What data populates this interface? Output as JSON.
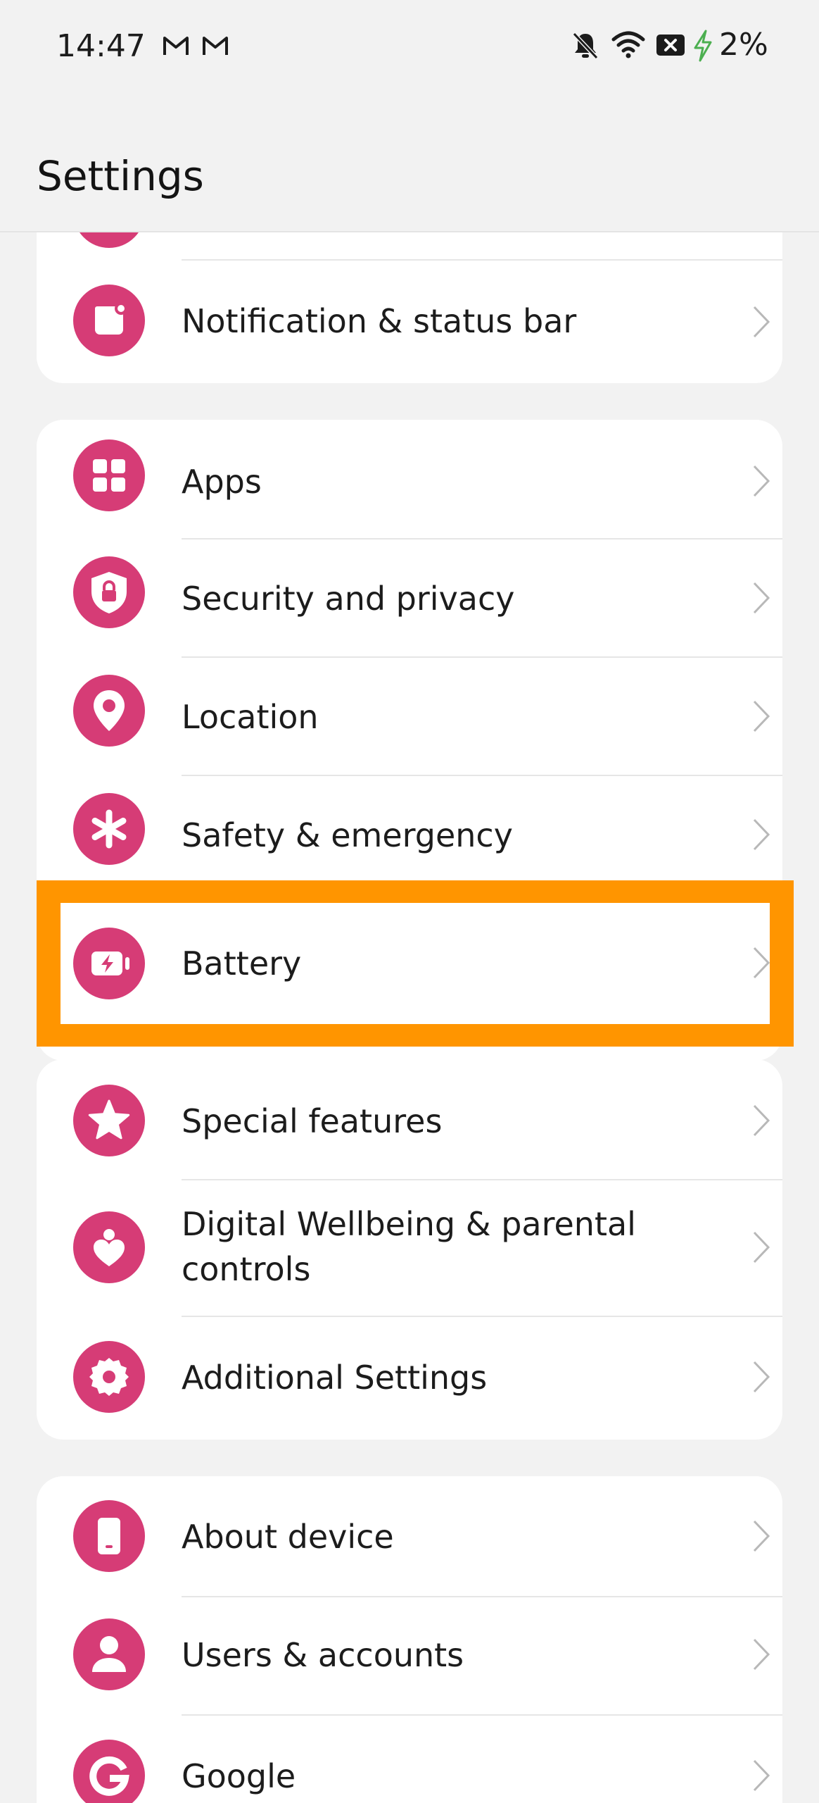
{
  "status_bar": {
    "time": "14:47",
    "notifications": [
      "gmail-icon",
      "gmail-icon"
    ],
    "system_icons": [
      "muted-bell-icon",
      "wifi-icon",
      "x-badge-icon",
      "charging-bolt-icon"
    ],
    "battery_percent": "2%"
  },
  "header": {
    "title": "Settings"
  },
  "colors": {
    "icon_accent": "#d63c76",
    "highlight": "#ff9500",
    "background": "#f2f2f2",
    "card": "#ffffff"
  },
  "groups": [
    {
      "items": [
        {
          "label": "Notification & status bar",
          "icon": "notification-icon"
        }
      ]
    },
    {
      "items": [
        {
          "label": "Apps",
          "icon": "apps-grid-icon"
        },
        {
          "label": "Security and privacy",
          "icon": "shield-lock-icon"
        },
        {
          "label": "Location",
          "icon": "location-pin-icon"
        },
        {
          "label": "Safety & emergency",
          "icon": "asterisk-icon"
        },
        {
          "label": "Battery",
          "icon": "battery-icon"
        }
      ]
    },
    {
      "items": [
        {
          "label": "Special features",
          "icon": "star-icon"
        },
        {
          "label": "Digital Wellbeing & parental controls",
          "icon": "heart-person-icon"
        },
        {
          "label": "Additional Settings",
          "icon": "gear-icon"
        }
      ]
    },
    {
      "items": [
        {
          "label": "About device",
          "icon": "phone-icon"
        },
        {
          "label": "Users & accounts",
          "icon": "user-icon"
        },
        {
          "label": "Google",
          "icon": "google-icon"
        }
      ]
    }
  ]
}
